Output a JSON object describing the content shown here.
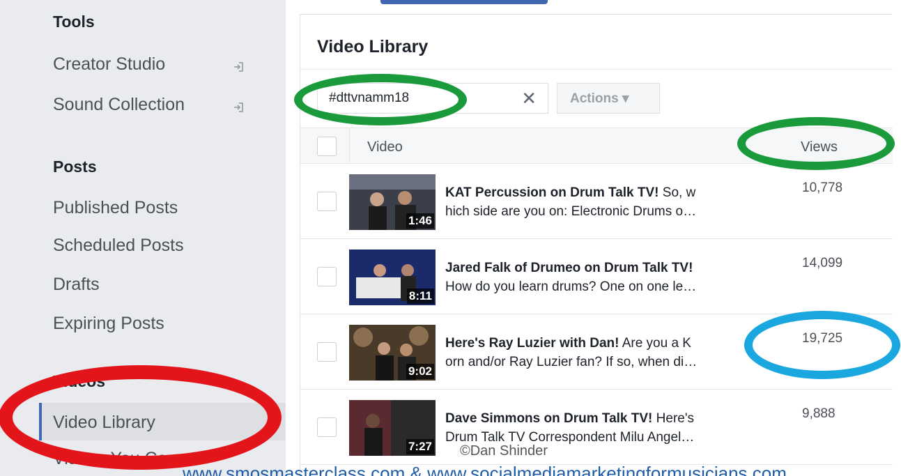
{
  "sidebar": {
    "tools_heading": "Tools",
    "tools_items": [
      {
        "label": "Creator Studio",
        "external_icon": "external-link-icon"
      },
      {
        "label": "Sound Collection",
        "external_icon": "external-link-icon"
      }
    ],
    "posts_heading": "Posts",
    "posts_items": [
      "Published Posts",
      "Scheduled Posts",
      "Drafts",
      "Expiring Posts"
    ],
    "videos_heading": "Videos",
    "videos_items": [
      {
        "label": "Video Library",
        "active": true
      },
      {
        "label": "Videos You Can"
      }
    ]
  },
  "main": {
    "title": "Video Library",
    "search": {
      "value": "#dttvnamm18",
      "clear_icon": "close-icon"
    },
    "actions_button": "Actions ▾",
    "columns": {
      "video": "Video",
      "views": "Views"
    },
    "rows": [
      {
        "duration": "1:46",
        "title_bold": "KAT Percussion on Drum Talk TV!",
        "title_rest": " So, w",
        "line2": "hich side are you on: Electronic Drums o…",
        "views": "10,778"
      },
      {
        "duration": "8:11",
        "title_bold": "Jared Falk of Drumeo on Drum Talk TV!",
        "title_rest": "",
        "line2": "How do you learn drums? One on one le…",
        "views": "14,099"
      },
      {
        "duration": "9:02",
        "title_bold": "Here's Ray Luzier with Dan!",
        "title_rest": " Are you a K",
        "line2": "orn and/or Ray Luzier fan? If so, when di…",
        "views": "19,725"
      },
      {
        "duration": "7:27",
        "title_bold": "Dave Simmons on Drum Talk TV!",
        "title_rest": " Here's",
        "line2": "Drum Talk TV Correspondent Milu Angel…",
        "views": "9,888"
      }
    ]
  },
  "annotations": {
    "colors": {
      "green": "#1a9a3a",
      "red": "#e4141b",
      "blue": "#1aa7e0"
    }
  },
  "watermark": "©Dan Shinder",
  "footer": "www.smosmasterclass.com & www.socialmediamarketingformusicians.com"
}
